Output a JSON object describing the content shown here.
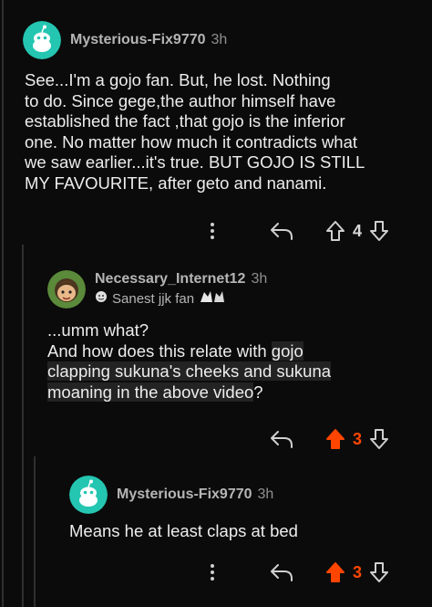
{
  "thread": {
    "comment1": {
      "username": "Mysterious-Fix9770",
      "time": "3h",
      "body": "See...I'm a gojo fan. But, he lost. Nothing\nto do. Since gege,the author himself have\nestablished the fact ,that gojo is the inferior\none. No matter how much it contradicts what\nwe saw earlier...it's true. BUT GOJO IS STILL\nMY FAVOURITE, after geto and nanami.",
      "score": "4",
      "upvoted": false
    },
    "comment2": {
      "username": "Necessary_Internet12",
      "time": "3h",
      "flair": "Sanest jjk fan",
      "line1": "...umm what?",
      "line2_prefix": "And how does this relate with ",
      "quoted": [
        "gojo",
        "clapping sukuna's cheeks and sukuna",
        "moaning in the above video"
      ],
      "line_end": "?",
      "score": "3",
      "upvoted": true
    },
    "comment3": {
      "username": "Mysterious-Fix9770",
      "time": "3h",
      "body": "Means he at least claps at bed",
      "score": "3",
      "upvoted": true
    }
  },
  "colors": {
    "background": "#0b0b0b",
    "upvote_active": "#ff4500",
    "snoo_avatar": "#24c6b1",
    "thread_line": "#2f2f2f"
  },
  "icons": [
    "more-icon",
    "reply-icon",
    "upvote-icon",
    "downvote-icon",
    "snoo-avatar-icon",
    "flair-emoji-icon"
  ]
}
